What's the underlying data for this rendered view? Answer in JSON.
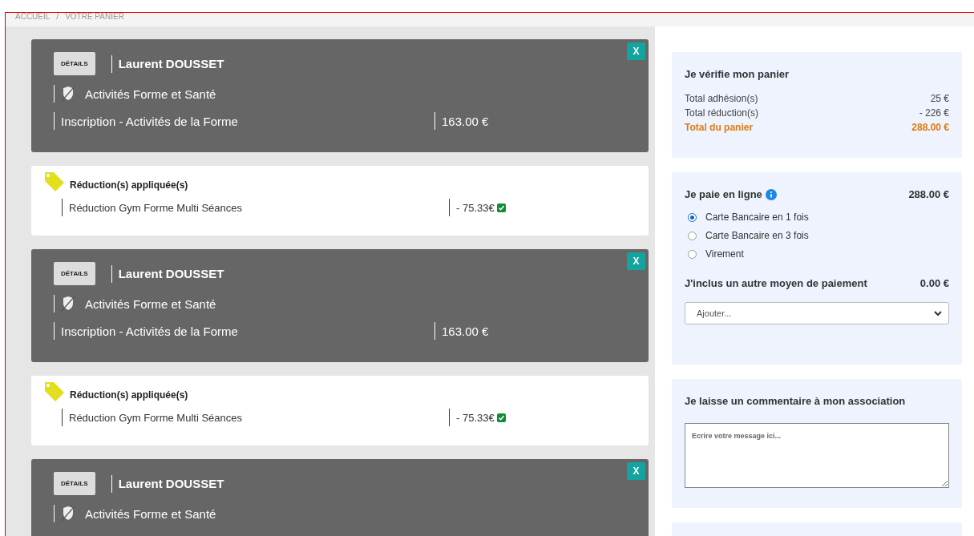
{
  "breadcrumb": {
    "items": [
      "ACCUEIL",
      "VOTRE PANIER"
    ],
    "separator": "/"
  },
  "cart": [
    {
      "kind": "item",
      "details_label": "DÉTAILS",
      "remove_label": "X",
      "member": "Laurent DOUSSET",
      "activity": "Activités Forme et Santé",
      "inscription": "Inscription - Activités de la Forme",
      "price": "163.00 €"
    },
    {
      "kind": "reduction",
      "title": "Réduction(s) appliquée(s)",
      "name": "Réduction Gym Forme Multi Séances",
      "amount": "- 75.33€",
      "checked": true
    },
    {
      "kind": "item",
      "details_label": "DÉTAILS",
      "remove_label": "X",
      "member": "Laurent DOUSSET",
      "activity": "Activités Forme et Santé",
      "inscription": "Inscription - Activités de la Forme",
      "price": "163.00 €"
    },
    {
      "kind": "reduction",
      "title": "Réduction(s) appliquée(s)",
      "name": "Réduction Gym Forme Multi Séances",
      "amount": "- 75.33€",
      "checked": true
    },
    {
      "kind": "item",
      "details_label": "DÉTAILS",
      "remove_label": "X",
      "member": "Laurent DOUSSET",
      "activity": "Activités Forme et Santé"
    }
  ],
  "summary": {
    "title": "Je vérifie mon panier",
    "rows": [
      {
        "label": "Total adhésion(s)",
        "value": "25 €",
        "highlight": false
      },
      {
        "label": "Total réduction(s)",
        "value": "- 226 €",
        "highlight": false
      },
      {
        "label": "Total du panier",
        "value": "288.00 €",
        "highlight": true
      }
    ]
  },
  "payment": {
    "title": "Je paie en ligne",
    "amount": "288.00 €",
    "options": [
      {
        "label": "Carte Bancaire en 1 fois",
        "selected": true
      },
      {
        "label": "Carte Bancaire en 3 fois",
        "selected": false
      },
      {
        "label": "Virement",
        "selected": false
      }
    ],
    "other_title": "J'inclus un autre moyen de paiement",
    "other_amount": "0.00 €",
    "select_value": "Ajouter..."
  },
  "comment": {
    "title": "Je laisse un commentaire à mon association",
    "placeholder": "Ecrire votre message ici..."
  }
}
